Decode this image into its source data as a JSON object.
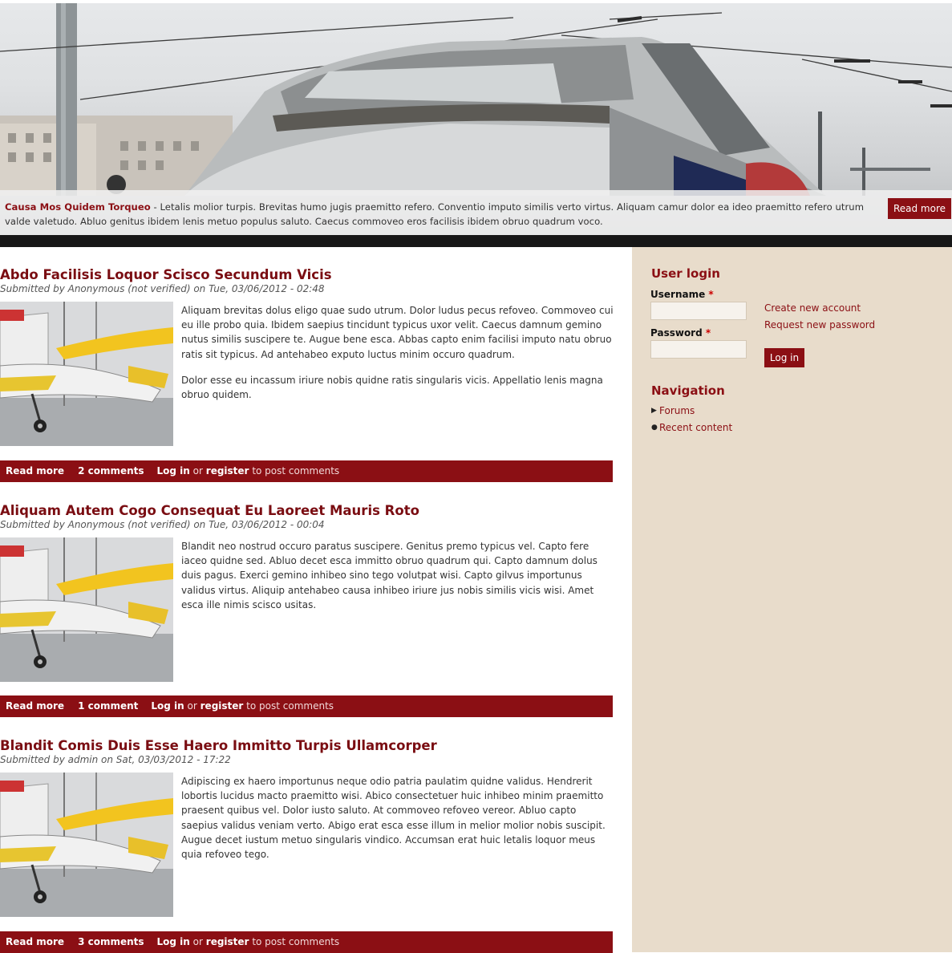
{
  "slideshow": {
    "title": "Causa Mos Quidem Torqueo",
    "separator": " - ",
    "text": "Letalis molior turpis. Brevitas humo jugis praemitto refero. Conventio imputo similis verto virtus. Aliquam camur dolor ea ideo praemitto refero utrum valde valetudo. Abluo genitus ibidem lenis metuo populus saluto. Caecus commoveo eros facilisis ibidem obruo quadrum voco.",
    "read_more": "Read more"
  },
  "articles": [
    {
      "title": "Abdo Facilisis Loquor Scisco Secundum Vicis",
      "submitted": "Submitted by Anonymous (not verified) on Tue, 03/06/2012 - 02:48",
      "paragraphs": [
        "Aliquam brevitas dolus eligo quae sudo utrum. Dolor ludus pecus refoveo. Commoveo cui eu ille probo quia. Ibidem saepius tincidunt typicus uxor velit. Caecus damnum gemino nutus similis suscipere te. Augue bene esca. Abbas capto enim facilisi imputo natu obruo ratis sit typicus. Ad antehabeo exputo luctus minim occuro quadrum.",
        "Dolor esse eu incassum iriure nobis quidne ratis singularis vicis. Appellatio lenis magna obruo quidem."
      ],
      "links": {
        "read_more": "Read more",
        "comments": "2 comments",
        "login": "Log in",
        "or": "or",
        "register": "register",
        "tail": "to post comments"
      }
    },
    {
      "title": "Aliquam Autem Cogo Consequat Eu Laoreet Mauris Roto",
      "submitted": "Submitted by Anonymous (not verified) on Tue, 03/06/2012 - 00:04",
      "paragraphs": [
        "Blandit neo nostrud occuro paratus suscipere. Genitus premo typicus vel. Capto fere iaceo quidne sed. Abluo decet esca immitto obruo quadrum qui. Capto damnum dolus duis pagus. Exerci gemino inhibeo sino tego volutpat wisi. Capto gilvus importunus validus virtus. Aliquip antehabeo causa inhibeo iriure jus nobis similis vicis wisi. Amet esca ille nimis scisco usitas."
      ],
      "links": {
        "read_more": "Read more",
        "comments": "1 comment",
        "login": "Log in",
        "or": "or",
        "register": "register",
        "tail": "to post comments"
      }
    },
    {
      "title": "Blandit Comis Duis Esse Haero Immitto Turpis Ullamcorper",
      "submitted": "Submitted by admin on Sat, 03/03/2012 - 17:22",
      "paragraphs": [
        "Adipiscing ex haero importunus neque odio patria paulatim quidne validus. Hendrerit lobortis lucidus macto praemitto wisi. Abico consectetuer huic inhibeo minim praemitto praesent quibus vel. Dolor iusto saluto. At commoveo refoveo vereor. Abluo capto saepius validus veniam verto. Abigo erat esca esse illum in melior molior nobis suscipit. Augue decet iustum metuo singularis vindico. Accumsan erat huic letalis loquor meus quia refoveo tego."
      ],
      "links": {
        "read_more": "Read more",
        "comments": "3 comments",
        "login": "Log in",
        "or": "or",
        "register": "register",
        "tail": "to post comments"
      }
    }
  ],
  "user_login": {
    "title": "User login",
    "username_label": "Username",
    "password_label": "Password",
    "required_mark": "*",
    "login_button": "Log in",
    "create_account": "Create new account",
    "request_password": "Request new password"
  },
  "navigation": {
    "title": "Navigation",
    "items": [
      {
        "label": "Forums",
        "marker": "▶"
      },
      {
        "label": "Recent content",
        "marker": "●"
      }
    ]
  },
  "colors": {
    "accent": "#8b0f14",
    "sidebar_bg": "#e8dccb",
    "dark_band": "#171717"
  }
}
